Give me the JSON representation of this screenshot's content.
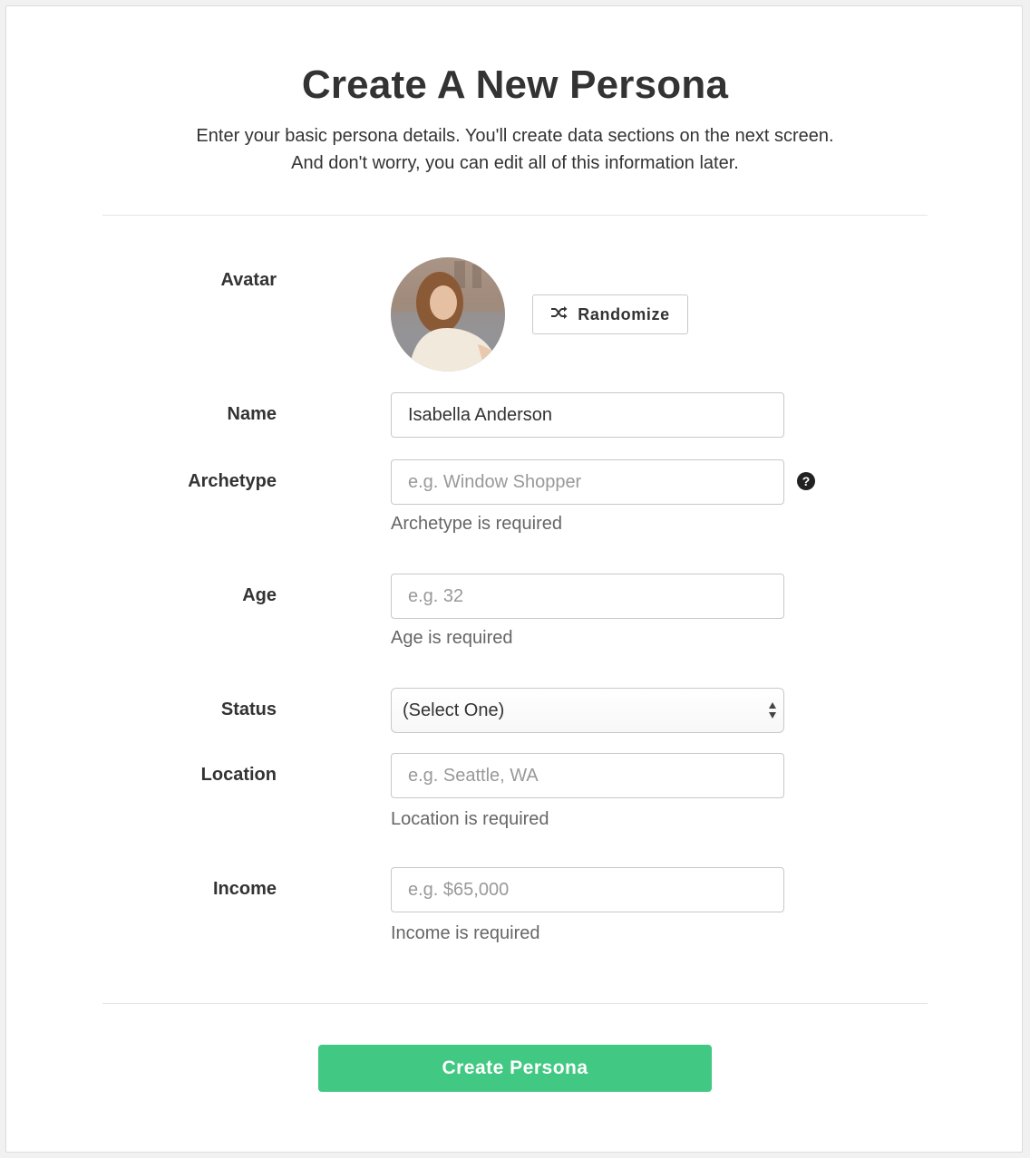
{
  "header": {
    "title": "Create A New Persona",
    "subtitle_line1": "Enter your basic persona details. You'll create data sections on the next screen.",
    "subtitle_line2": "And don't worry, you can edit all of this information later."
  },
  "form": {
    "avatar": {
      "label": "Avatar",
      "randomize_label": "Randomize",
      "randomize_icon": "shuffle-icon"
    },
    "name": {
      "label": "Name",
      "value": "Isabella Anderson"
    },
    "archetype": {
      "label": "Archetype",
      "value": "",
      "placeholder": "e.g. Window Shopper",
      "error": "Archetype is required",
      "help_icon": "question-circle-icon"
    },
    "age": {
      "label": "Age",
      "value": "",
      "placeholder": "e.g. 32",
      "error": "Age is required"
    },
    "status": {
      "label": "Status",
      "selected": "(Select One)"
    },
    "location": {
      "label": "Location",
      "value": "",
      "placeholder": "e.g. Seattle, WA",
      "error": "Location is required"
    },
    "income": {
      "label": "Income",
      "value": "",
      "placeholder": "e.g. $65,000",
      "error": "Income is required"
    }
  },
  "actions": {
    "submit_label": "Create Persona"
  },
  "colors": {
    "primary_button": "#41c882",
    "text": "#333333",
    "muted_text": "#666666"
  }
}
